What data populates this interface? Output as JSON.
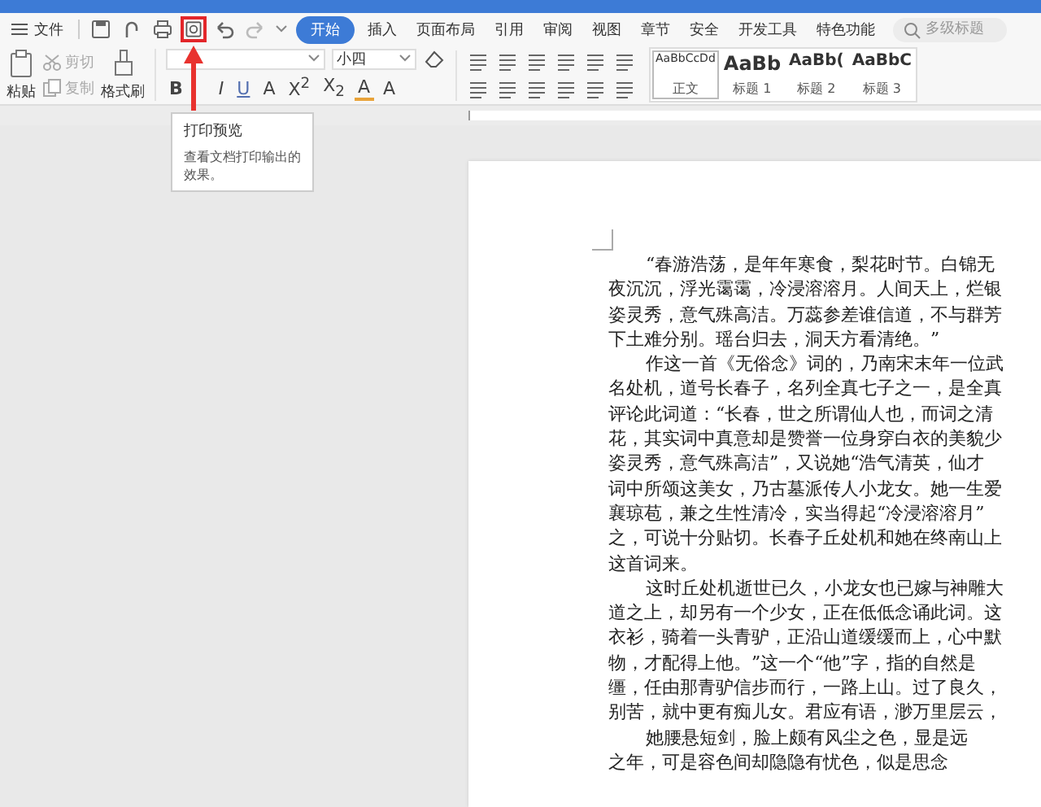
{
  "menu_bar": {
    "file_label": "文件",
    "quick_access": [
      {
        "kind": "save",
        "highlighted": false
      },
      {
        "kind": "redo-alt",
        "highlighted": false
      },
      {
        "kind": "print",
        "highlighted": false
      },
      {
        "kind": "preview",
        "highlighted": true
      },
      {
        "kind": "undo",
        "highlighted": false
      },
      {
        "kind": "redo",
        "highlighted": false
      }
    ],
    "tabs": [
      {
        "label": "开始",
        "selected": true
      },
      {
        "label": "插入",
        "selected": false
      },
      {
        "label": "页面布局",
        "selected": false
      },
      {
        "label": "引用",
        "selected": false
      },
      {
        "label": "审阅",
        "selected": false
      },
      {
        "label": "视图",
        "selected": false
      },
      {
        "label": "章节",
        "selected": false
      },
      {
        "label": "安全",
        "selected": false
      },
      {
        "label": "开发工具",
        "selected": false
      },
      {
        "label": "特色功能",
        "selected": false
      }
    ],
    "search": {
      "placeholder": "多级标题"
    }
  },
  "ribbon": {
    "paste": "粘贴",
    "cut": "剪切",
    "copy": "复制",
    "format_painter": "格式刷",
    "font_size": "小四",
    "format_buttons": [
      "B",
      "I",
      "U",
      "A",
      "X$^{2}$",
      "X$_{2}$",
      "A",
      "A"
    ],
    "styles": [
      {
        "sample": "AaBbCcDd",
        "label": "正文",
        "selected": true
      },
      {
        "sample": "AaBb",
        "label": "标题 1",
        "selected": false
      },
      {
        "sample": "AaBb(",
        "label": "标题 2",
        "selected": false
      },
      {
        "sample": "AaBbC",
        "label": "标题 3",
        "selected": false
      }
    ]
  },
  "tooltip": {
    "title": "打印预览",
    "text": "查看文档打印输出的效果。"
  },
  "document": {
    "paragraphs": [
      {
        "lines": [
          "“春游浩荡，是年年寒食，梨花时节。白锦无",
          "夜沉沉，浮光霭霭，冷浸溶溶月。人间天上，烂银",
          "姿灵秀，意气殊高洁。万蕊参差谁信道，不与群芳",
          "下土难分别。瑶台归去，洞天方看清绝。”"
        ]
      },
      {
        "lines": [
          "作这一首《无俗念》词的，乃南宋末年一位武",
          "名处机，道号长春子，名列全真七子之一，是全真",
          "评论此词道：“长春，世之所谓仙人也，而词之清",
          "花，其实词中真意却是赞誉一位身穿白衣的美貌少",
          "姿灵秀，意气殊高洁”，又说她“浩气清英，仙才",
          "词中所颂这美女，乃古墓派传人小龙女。她一生爱",
          "襄琼苞，兼之生性清冷，实当得起“冷浸溶溶月”",
          "之，可说十分贴切。长春子丘处机和她在终南山上",
          "这首词来。"
        ]
      },
      {
        "lines": [
          "这时丘处机逝世已久，小龙女也已嫁与神雕大",
          "道之上，却另有一个少女，正在低低念诵此词。这",
          "衣衫，骑着一头青驴，正沿山道缓缓而上，心中默",
          "物，才配得上他。”这一个“他”字，指的自然是",
          "缰，任由那青驴信步而行，一路上山。过了良久，",
          "别苦，就中更有痴儿女。君应有语，渺万里层云，"
        ]
      },
      {
        "lines": [
          "她腰悬短剑，脸上颇有风尘之色，显是远",
          "之年，可是容色间却隐隐有忧色，似是思念"
        ]
      }
    ]
  }
}
